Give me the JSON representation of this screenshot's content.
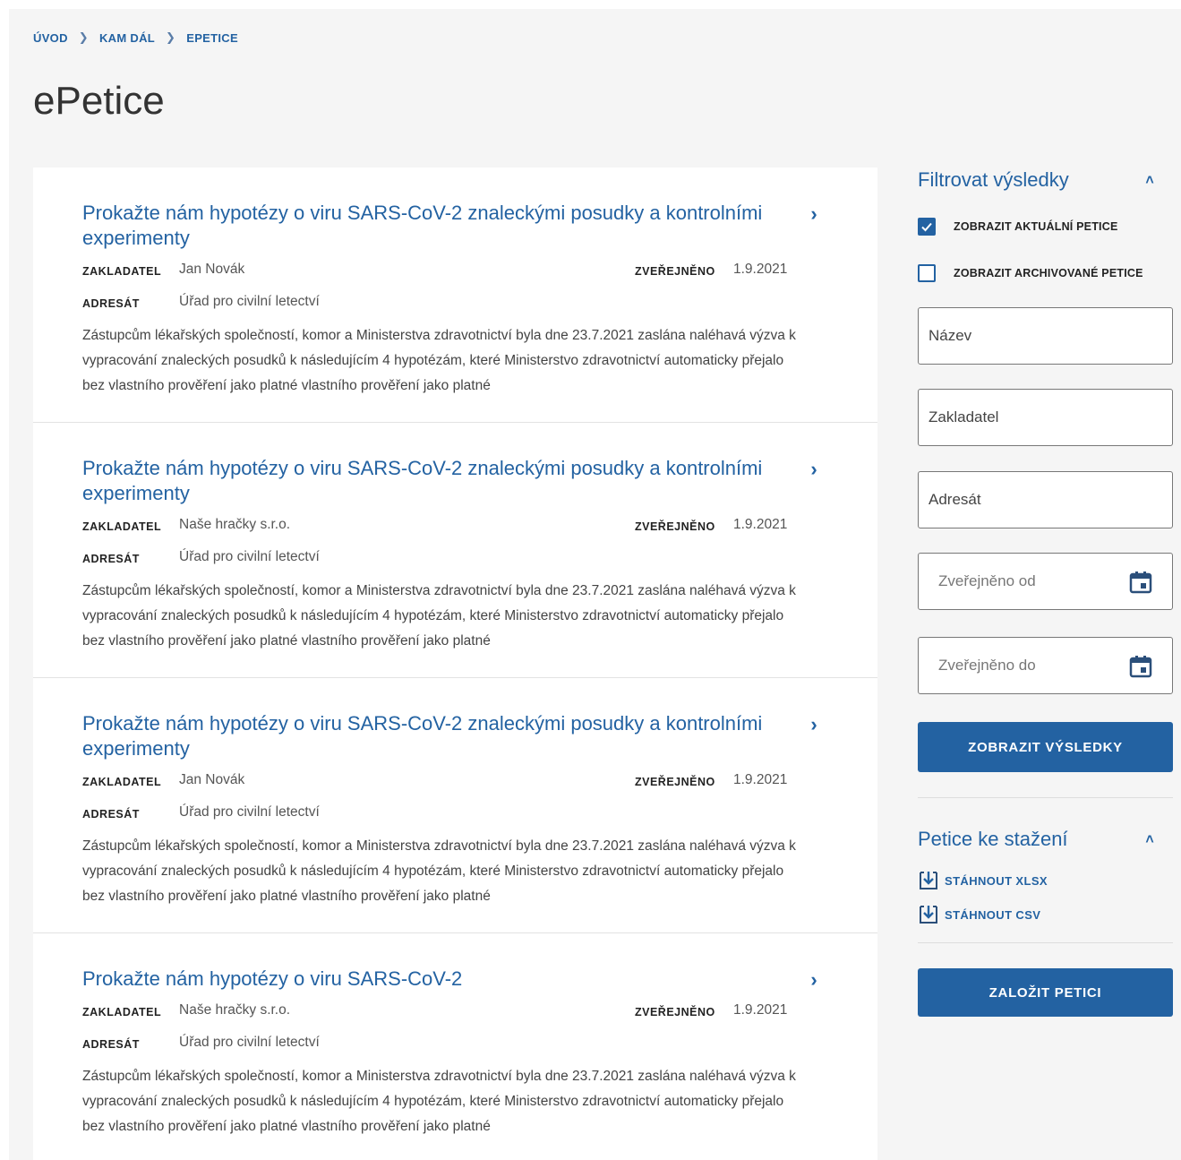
{
  "breadcrumb": [
    "ÚVOD",
    "KAM DÁL",
    "EPETICE"
  ],
  "page_title": "ePetice",
  "labels": {
    "founder": "ZAKLADATEL",
    "published": "ZVEŘEJNĚNO",
    "addressee": "ADRESÁT"
  },
  "petitions": [
    {
      "title": "Prokažte nám hypotézy o viru SARS-CoV-2 znaleckými posudky a kontrolními experimenty",
      "founder": "Jan Novák",
      "published": "1.9.2021",
      "addressee": "Úřad pro civilní letectví",
      "desc": "Zástupcům lékařských společností, komor a Ministerstva zdravotnictví byla dne 23.7.2021 zaslána naléhavá výzva k vypracování znaleckých posudků k následujícím 4 hypotézám, které Ministerstvo zdravotnictví automaticky přejalo bez vlastního prověření jako platné vlastního prověření jako platné"
    },
    {
      "title": "Prokažte nám hypotézy o viru SARS-CoV-2 znaleckými posudky a kontrolními experimenty",
      "founder": "Naše hračky s.r.o.",
      "published": "1.9.2021",
      "addressee": "Úřad pro civilní letectví",
      "desc": "Zástupcům lékařských společností, komor a Ministerstva zdravotnictví byla dne 23.7.2021 zaslána naléhavá výzva k vypracování znaleckých posudků k následujícím 4 hypotézám, které Ministerstvo zdravotnictví automaticky přejalo bez vlastního prověření jako platné vlastního prověření jako platné"
    },
    {
      "title": "Prokažte nám hypotézy o viru SARS-CoV-2 znaleckými posudky a kontrolními experimenty",
      "founder": "Jan Novák",
      "published": "1.9.2021",
      "addressee": "Úřad pro civilní letectví",
      "desc": "Zástupcům lékařských společností, komor a Ministerstva zdravotnictví byla dne 23.7.2021 zaslána naléhavá výzva k vypracování znaleckých posudků k následujícím 4 hypotézám, které Ministerstvo zdravotnictví automaticky přejalo bez vlastního prověření jako platné vlastního prověření jako platné"
    },
    {
      "title": "Prokažte nám hypotézy o viru SARS-CoV-2",
      "founder": "Naše hračky s.r.o.",
      "published": "1.9.2021",
      "addressee": "Úřad pro civilní letectví",
      "desc": "Zástupcům lékařských společností, komor a Ministerstva zdravotnictví byla dne 23.7.2021 zaslána naléhavá výzva k vypracování znaleckých posudků k následujícím 4 hypotézám, které Ministerstvo zdravotnictví automaticky přejalo bez vlastního prověření jako platné vlastního prověření jako platné"
    }
  ],
  "filter": {
    "title": "Filtrovat výsledky",
    "show_current": {
      "label": "ZOBRAZIT AKTUÁLNÍ PETICE",
      "checked": true
    },
    "show_archived": {
      "label": "ZOBRAZIT ARCHIVOVANÉ PETICE",
      "checked": false
    },
    "name_placeholder": "Název",
    "founder_placeholder": "Zakladatel",
    "addressee_placeholder": "Adresát",
    "published_from_placeholder": "Zveřejněno od",
    "published_to_placeholder": "Zveřejněno do",
    "submit_label": "ZOBRAZIT VÝSLEDKY"
  },
  "downloads": {
    "title": "Petice ke stažení",
    "xlsx_label": "STÁHNOUT XLSX",
    "csv_label": "STÁHNOUT CSV"
  },
  "create_label": "ZALOŽIT PETICI",
  "colors": {
    "accent": "#2362a2",
    "page_bg": "#f5f5f5",
    "card_bg": "#ffffff"
  }
}
